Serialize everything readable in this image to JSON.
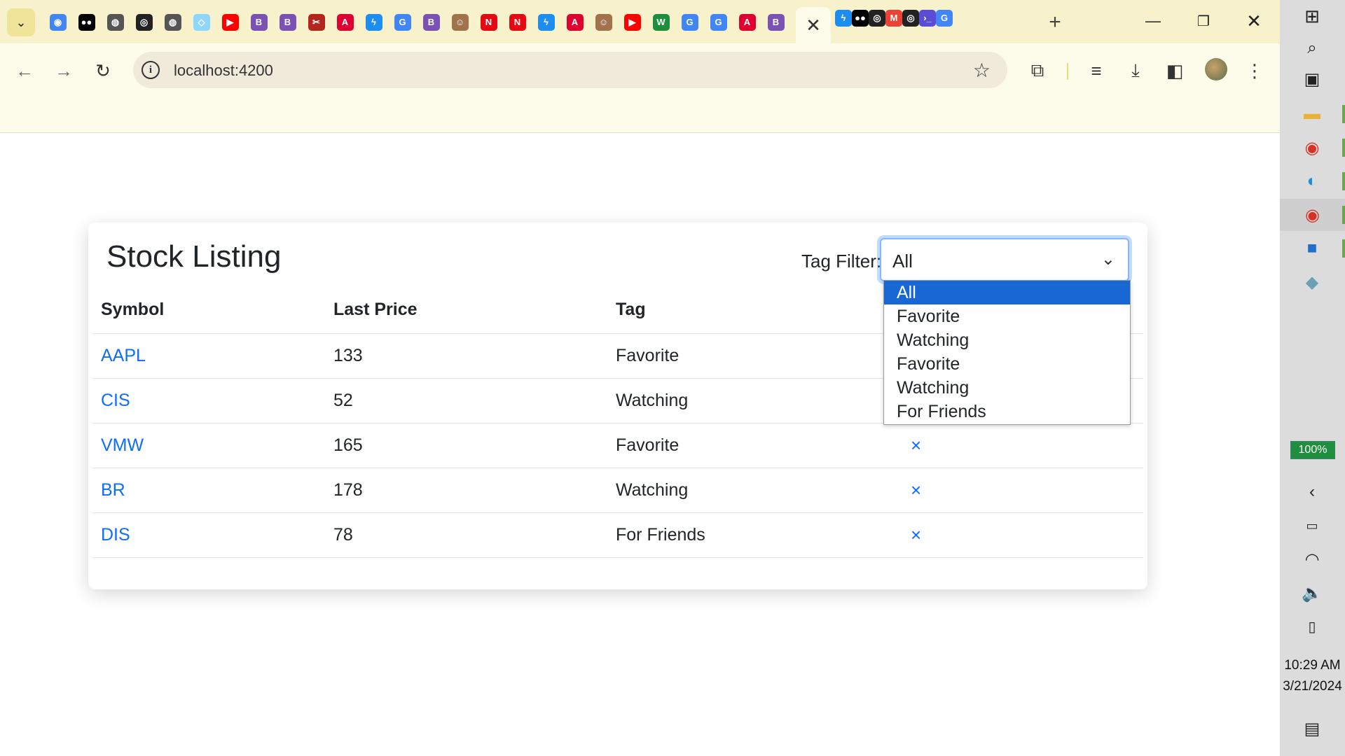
{
  "browser": {
    "url": "localhost:4200",
    "tab_icons_left": [
      "chrome-icon",
      "medium-icon",
      "globe-icon",
      "github-icon",
      "globe-icon",
      "webpack-icon",
      "youtube-icon",
      "bootstrap-icon",
      "bootstrap-icon",
      "scissors-icon",
      "angular-icon",
      "bolt-icon",
      "google-icon",
      "bootstrap-icon",
      "avatar-icon",
      "netflix-icon",
      "netflix-icon",
      "bolt-icon",
      "angular-icon",
      "avatar-icon",
      "youtube-icon",
      "w-icon",
      "google-icon",
      "google-icon",
      "angular-icon",
      "bootstrap-icon"
    ],
    "tab_icons_right": [
      "bolt-icon",
      "medium-icon",
      "github-icon",
      "gmail-icon",
      "github-icon",
      "terminal-icon",
      "google-icon"
    ],
    "active_tab_close": "✕",
    "new_tab": "+"
  },
  "page": {
    "title": "Stock Listing",
    "filter": {
      "label": "Tag Filter:",
      "selected": "All",
      "options": [
        "All",
        "Favorite",
        "Watching",
        "Favorite",
        "Watching",
        "For Friends"
      ]
    },
    "table": {
      "headers": [
        "Symbol",
        "Last Price",
        "Tag",
        ""
      ],
      "rows": [
        {
          "symbol": "AAPL",
          "price": "133",
          "tag": "Favorite",
          "action": "×"
        },
        {
          "symbol": "CIS",
          "price": "52",
          "tag": "Watching",
          "action": "×"
        },
        {
          "symbol": "VMW",
          "price": "165",
          "tag": "Favorite",
          "action": "×"
        },
        {
          "symbol": "BR",
          "price": "178",
          "tag": "Watching",
          "action": "×"
        },
        {
          "symbol": "DIS",
          "price": "78",
          "tag": "For Friends",
          "action": "×"
        }
      ]
    }
  },
  "taskbar": {
    "battery": "100%",
    "time": "10:29 AM",
    "date": "3/21/2024"
  },
  "colors": {
    "link": "#0d6efd",
    "selected_option": "#1967d2",
    "tabstrip": "#f7f2cc"
  }
}
